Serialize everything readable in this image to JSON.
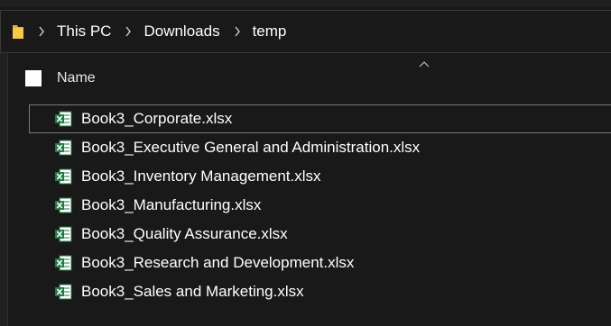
{
  "address_bar": {
    "folder_icon": "folder-icon",
    "breadcrumbs": [
      "This PC",
      "Downloads",
      "temp"
    ],
    "separator_icon": "chevron-right-icon"
  },
  "list": {
    "sort_indicator": "chevron-up-icon",
    "header": {
      "select_all_checked": false,
      "name_label": "Name"
    },
    "file_icon": "excel-file-icon",
    "files": [
      "Book3_Corporate.xlsx",
      "Book3_Executive General and Administration.xlsx",
      "Book3_Inventory Management.xlsx",
      "Book3_Manufacturing.xlsx",
      "Book3_Quality Assurance.xlsx",
      "Book3_Research and Development.xlsx",
      "Book3_Sales and Marketing.xlsx"
    ],
    "focused_index": 0
  },
  "colors": {
    "background": "#191919",
    "text": "#ffffff",
    "folder_yellow": "#f8c846",
    "excel_green": "#1f7a45",
    "focus_border": "#7a7a7a"
  }
}
